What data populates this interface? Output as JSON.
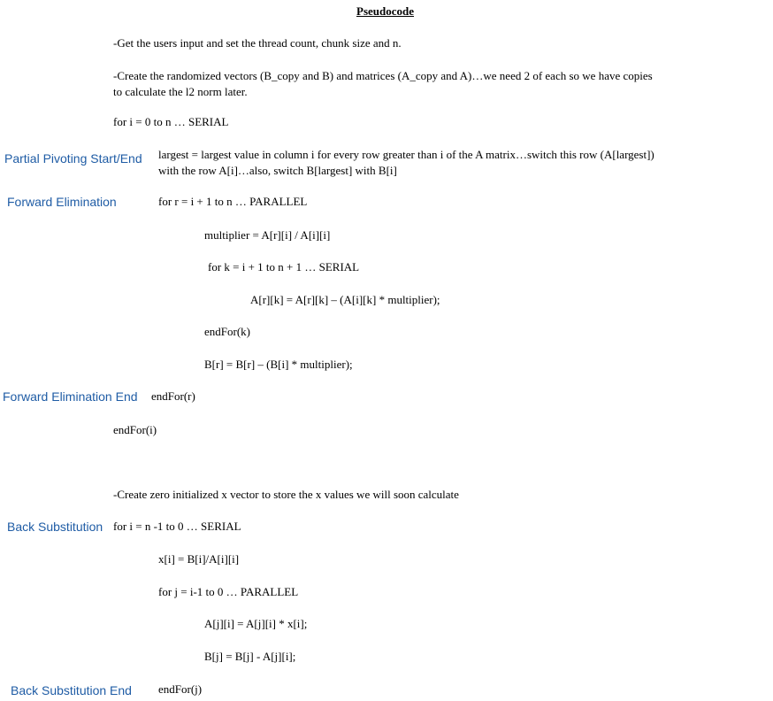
{
  "title": "Pseudocode",
  "lines": {
    "get_input": "-Get the users input and set the thread count, chunk size and n.",
    "create_vectors": "-Create the randomized vectors (B_copy and B) and matrices (A_copy and A)…we need 2 of each so we have copies to calculate the l2 norm later.",
    "for_i": "for i = 0 to n … SERIAL",
    "largest": "largest =  largest value in column i for every row greater than i of the A matrix…switch this row (A[largest]) with the row A[i]…also, switch B[largest] with B[i]",
    "for_r": "for r = i + 1 to n … PARALLEL",
    "multiplier": "multiplier = A[r][i] / A[i][i]",
    "for_k": "for  k = i + 1 to n + 1 … SERIAL",
    "a_update": "A[r][k] = A[r][k] – (A[i][k] * multiplier);",
    "end_k": "endFor(k)",
    "b_update": "B[r] = B[r] – (B[i] * multiplier);",
    "end_r": "endFor(r)",
    "end_i": "endFor(i)",
    "create_x": "-Create zero initialized x vector to store the x values we will soon calculate",
    "for_i_back": "for i = n -1 to 0 … SERIAL",
    "x_update": "x[i] = B[i]/A[i][i]",
    "for_j": "for j = i-1 to 0 … PARALLEL",
    "aj_update": "A[j][i] = A[j][i] * x[i];",
    "bj_update": "B[j] = B[j] - A[j][i];",
    "end_j": "endFor(j)"
  },
  "labels": {
    "partial_pivoting": "Partial Pivoting Start/End",
    "forward_elimination": "Forward Elimination",
    "forward_elimination_end": "Forward Elimination End",
    "back_substitution": "Back Substitution",
    "back_substitution_end": "Back Substitution End"
  },
  "colors": {
    "label": "#1f5ca5",
    "text": "#000000"
  }
}
